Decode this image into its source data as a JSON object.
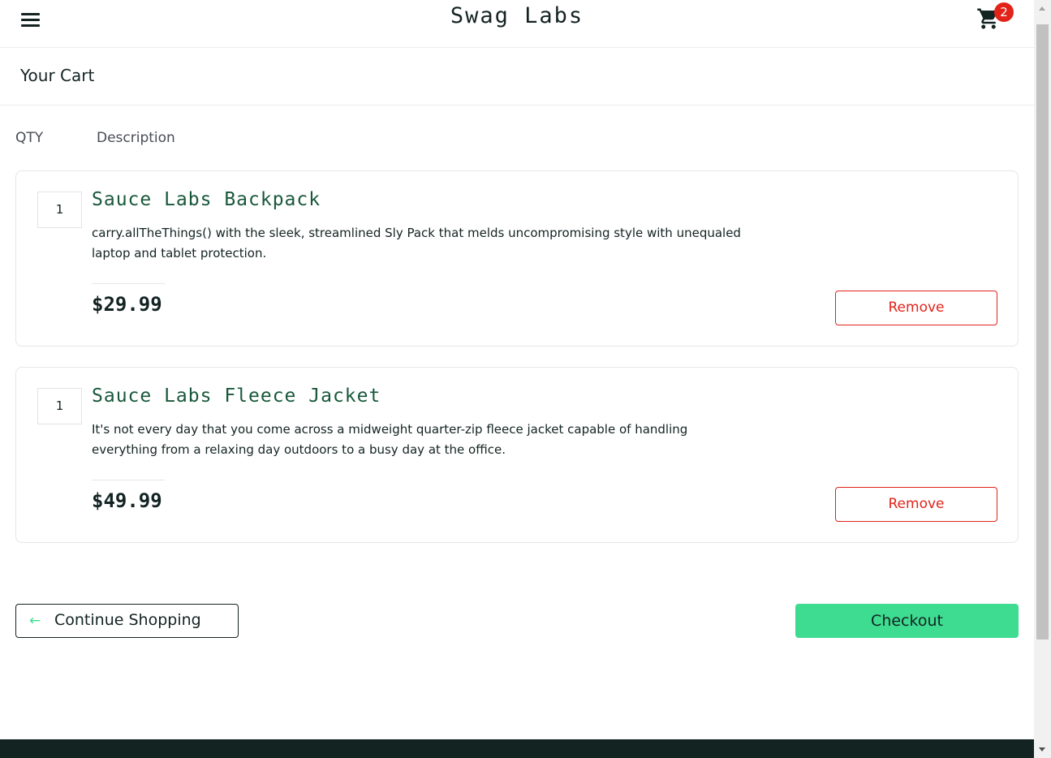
{
  "header": {
    "logo_text": "Swag Labs",
    "menu_icon": "hamburger-menu-icon",
    "cart_icon": "shopping-cart-icon",
    "cart_badge": "2"
  },
  "page": {
    "title": "Your Cart"
  },
  "list_header": {
    "qty": "QTY",
    "description": "Description"
  },
  "items": [
    {
      "quantity": "1",
      "name": "Sauce Labs Backpack",
      "description": "carry.allTheThings() with the sleek, streamlined Sly Pack that melds uncompromising style with unequaled laptop and tablet protection.",
      "price": "$29.99",
      "remove_label": "Remove"
    },
    {
      "quantity": "1",
      "name": "Sauce Labs Fleece Jacket",
      "description": "It's not every day that you come across a midweight quarter-zip fleece jacket capable of handling everything from a relaxing day outdoors to a busy day at the office.",
      "price": "$49.99",
      "remove_label": "Remove"
    }
  ],
  "actions": {
    "continue_arrow": "←",
    "continue_label": "Continue Shopping",
    "checkout_label": "Checkout"
  },
  "colors": {
    "accent": "#3ddc91",
    "remove": "#e2231a",
    "item_title": "#18583a",
    "footer": "#132322"
  }
}
